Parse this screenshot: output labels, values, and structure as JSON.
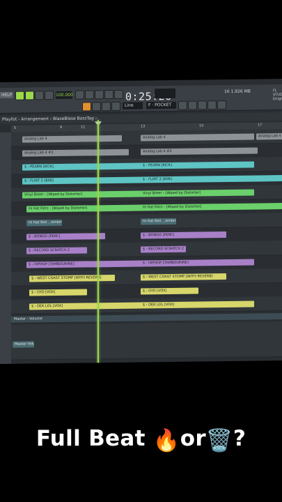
{
  "toolbar": {
    "help_label": "HELP",
    "tempo": "100.000",
    "time": "0:25:26",
    "snap": "Line",
    "pattern": "F · POCKET",
    "cpu": "16  1,926 MB",
    "brand": "FL STUDIO Enigma"
  },
  "playlist": {
    "title": "Playlist - Arrangement › BlaseBlase BossTag ›",
    "ruler": [
      "5",
      "9",
      "11",
      "13",
      "15",
      "17"
    ],
    "clips": [
      {
        "lane": 0,
        "label": "Analog Lab 4",
        "color": "white"
      },
      {
        "lane": 0,
        "label": "Analog Lab 4",
        "color": "white"
      },
      {
        "lane": 0,
        "label": "Analog Lab 4",
        "color": "white"
      },
      {
        "lane": 1,
        "label": "Analog Lab 4 #2",
        "color": "white"
      },
      {
        "lane": 1,
        "label": "Analog Lab 4 #2",
        "color": "white"
      },
      {
        "lane": 2,
        "label": "$ - PEARN [KICK]",
        "color": "cyan"
      },
      {
        "lane": 2,
        "label": "$ - PEARN [KICK]",
        "color": "cyan"
      },
      {
        "lane": 3,
        "label": "$ - FLINT 2 [808]",
        "color": "cyan"
      },
      {
        "lane": 3,
        "label": "$ - FLINT 2 [808]",
        "color": "cyan"
      },
      {
        "lane": 4,
        "label": "Vinyl Breer - [Wiped by Distorter]",
        "color": "green"
      },
      {
        "lane": 4,
        "label": "Vinyl Breer - [Wiped by Distorter]",
        "color": "green"
      },
      {
        "lane": 5,
        "label": "Hi Hat Ritrz - [Wiped by Distorter]",
        "color": "green"
      },
      {
        "lane": 5,
        "label": "Hi Hat Ritrz - [Wiped by Distorter]",
        "color": "green"
      },
      {
        "lane": 6,
        "label": "Hi Hat Roll ...Ambrile",
        "color": "teal"
      },
      {
        "lane": 6,
        "label": "Hi Hat Roll ...Ambrile",
        "color": "teal"
      },
      {
        "lane": 7,
        "label": "$ - BONGO [PERC]",
        "color": "purple"
      },
      {
        "lane": 7,
        "label": "$ - BONGO [PERC]",
        "color": "purple"
      },
      {
        "lane": 8,
        "label": "$ - RECORD SCRATCH 2",
        "color": "purple"
      },
      {
        "lane": 8,
        "label": "$ - RECORD SCRATCH 2",
        "color": "purple"
      },
      {
        "lane": 9,
        "label": "$ - HIPHOP [TAMBOURINE]",
        "color": "purple"
      },
      {
        "lane": 9,
        "label": "$ - HIPHOP [TAMBOURINE]",
        "color": "purple"
      },
      {
        "lane": 10,
        "label": "$ - WEST COAST STOMP [WITH REVERB]",
        "color": "yellow"
      },
      {
        "lane": 10,
        "label": "$ - WEST COAST STOMP [WITH REVERB]",
        "color": "yellow"
      },
      {
        "lane": 11,
        "label": "$ - GYO [VOX]",
        "color": "yellow"
      },
      {
        "lane": 11,
        "label": "$ - GYO [VOX]",
        "color": "yellow"
      },
      {
        "lane": 12,
        "label": "$ - DEK LOL [VOX]",
        "color": "yellow"
      },
      {
        "lane": 12,
        "label": "$ - DEK LOL [VOX]",
        "color": "yellow"
      }
    ],
    "automation_label": "Master - Volume",
    "bottom_clip": "Master Volume"
  },
  "caption": {
    "text_before": "Full Beat ",
    "fire": "🔥",
    "text_mid": "or",
    "trash": "🗑️",
    "text_after": "?"
  },
  "colors": {
    "white": "#8d9296",
    "cyan": "#5ec4c4",
    "green": "#6bd06b",
    "purple": "#a880c8",
    "yellow": "#d6d66a",
    "teal": "#4a6b72",
    "playhead": "#9bd84c"
  }
}
